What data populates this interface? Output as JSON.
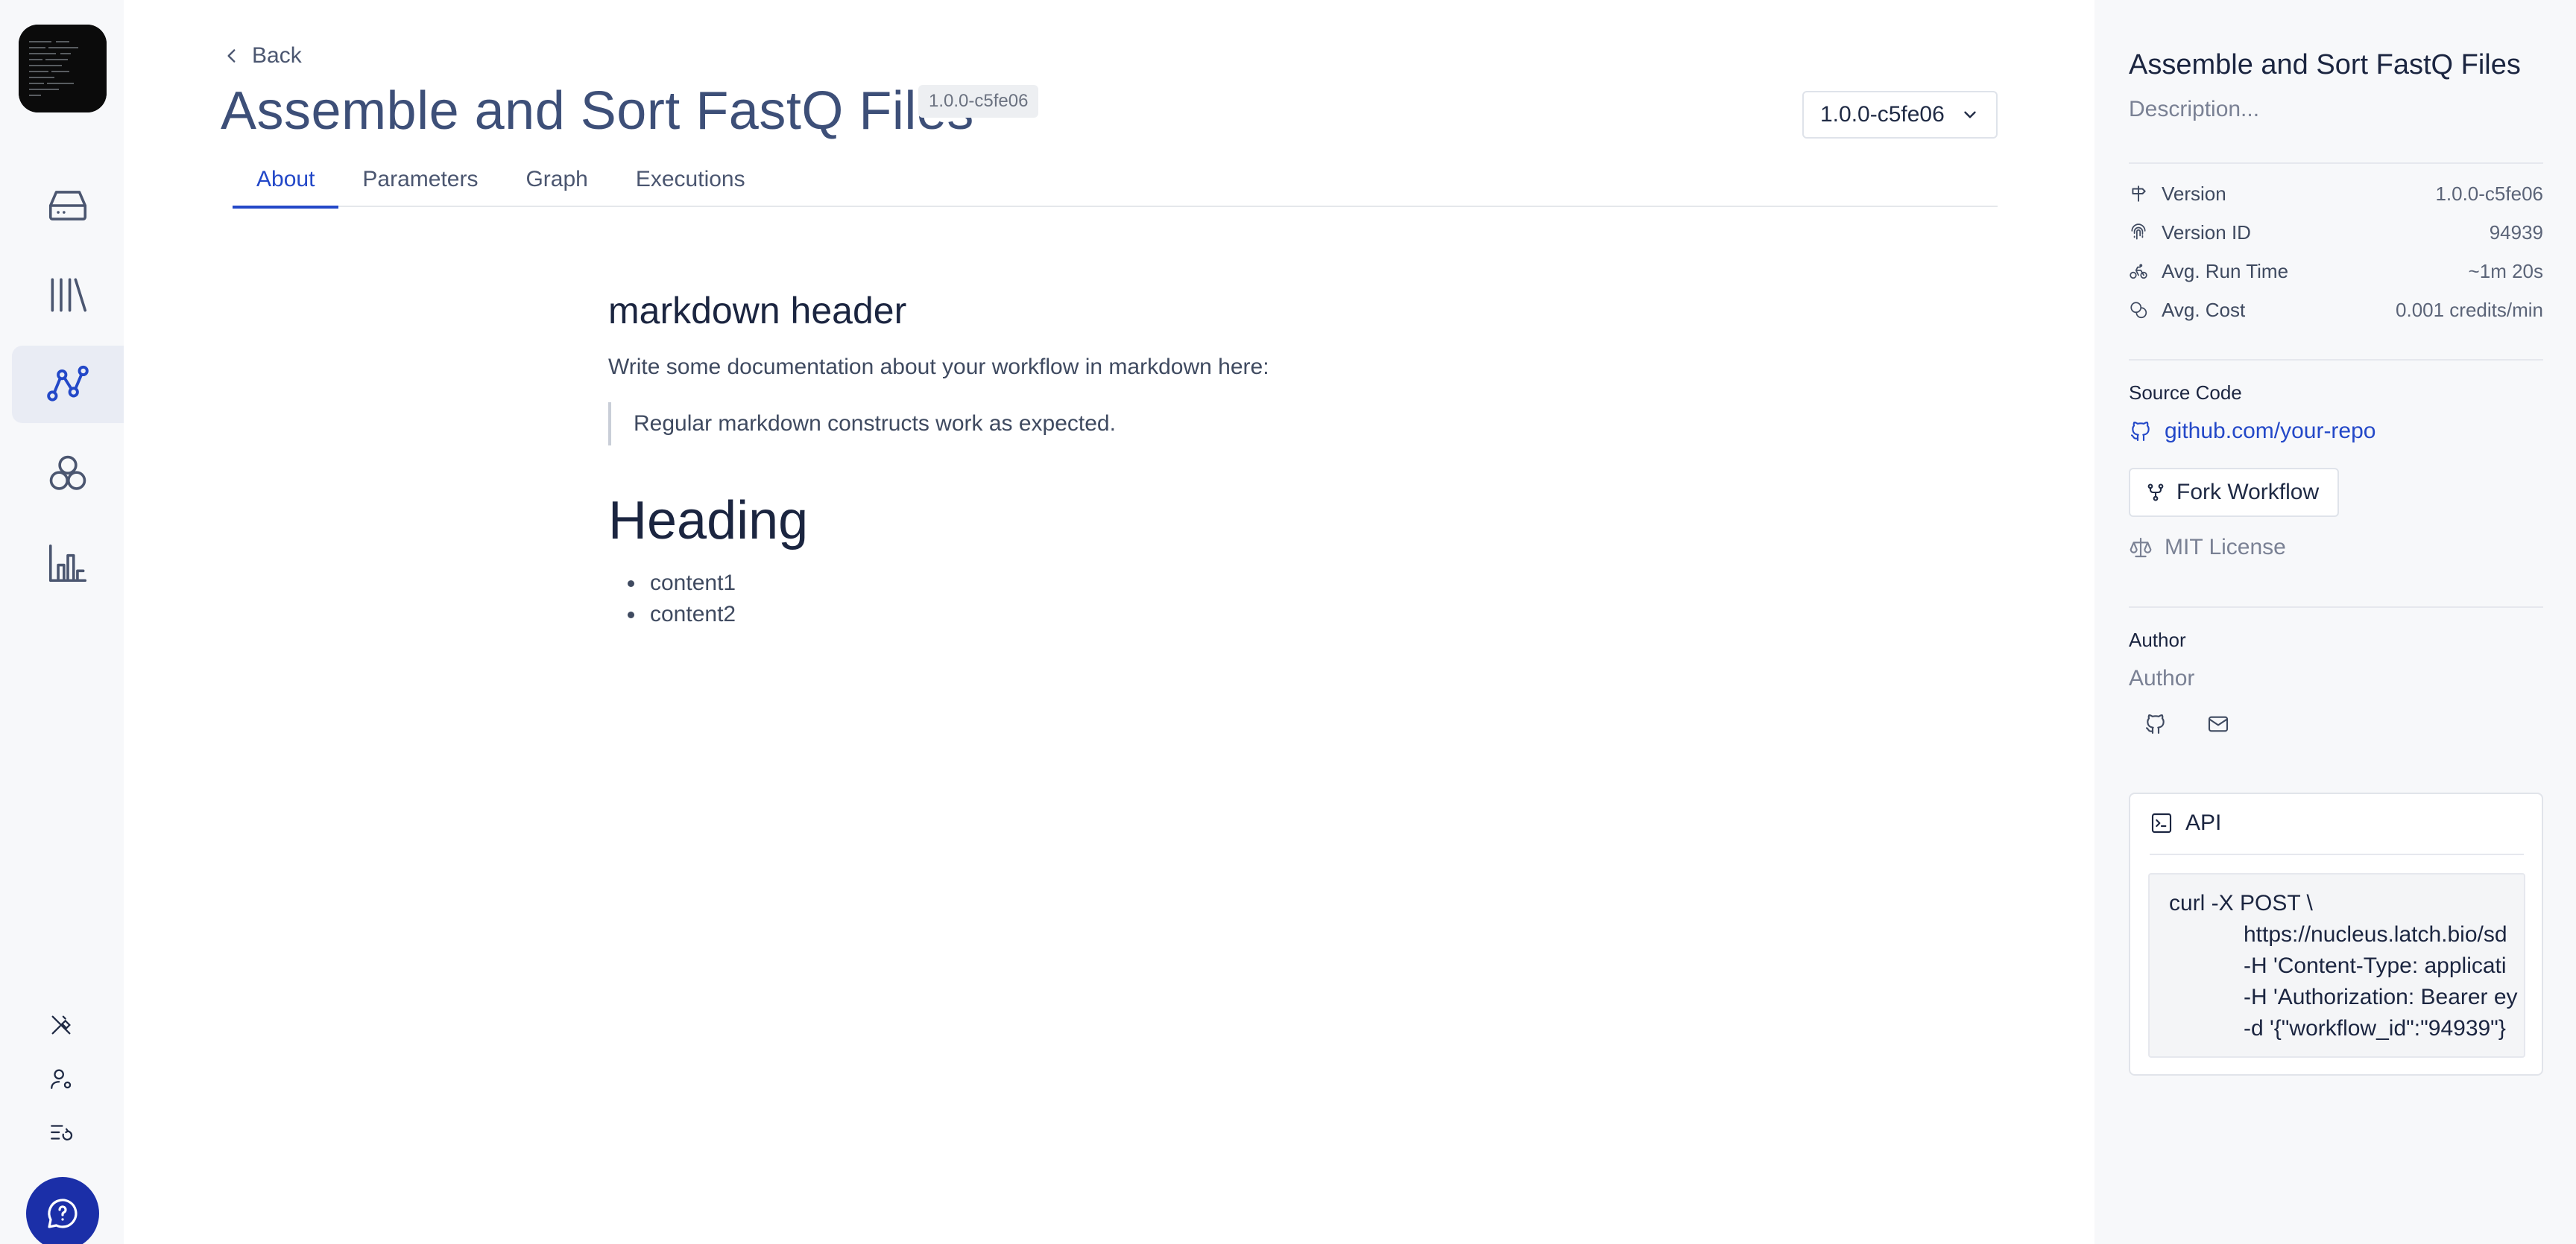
{
  "app": {
    "logo": "latch-terminal-logo",
    "nav": [
      {
        "icon": "drive-icon",
        "active": false
      },
      {
        "icon": "library-icon",
        "active": false
      },
      {
        "icon": "workflow-graph-icon",
        "active": true
      },
      {
        "icon": "hexagons-icon",
        "active": false
      },
      {
        "icon": "bar-chart-icon",
        "active": false
      }
    ],
    "bottom_nav": [
      "tools-icon",
      "user-settings-icon",
      "task-list-icon"
    ],
    "help_icon": "help-chat-icon",
    "accent_color": "#2348c8",
    "help_color": "#1b2fa8"
  },
  "header": {
    "back_label": "Back",
    "title": "Assemble and Sort FastQ Files",
    "version_tag": "1.0.0-c5fe06",
    "version_select": "1.0.0-c5fe06"
  },
  "tabs": [
    {
      "label": "About",
      "active": true
    },
    {
      "label": "Parameters",
      "active": false
    },
    {
      "label": "Graph",
      "active": false
    },
    {
      "label": "Executions",
      "active": false
    }
  ],
  "doc": {
    "h2": "markdown header",
    "paragraph": "Write some documentation about your workflow in markdown here:",
    "quote": "Regular markdown constructs work as expected.",
    "h1": "Heading",
    "list": [
      "content1",
      "content2"
    ]
  },
  "sidebar": {
    "title": "Assemble and Sort FastQ Files",
    "description": "Description...",
    "meta": [
      {
        "icon": "signpost-icon",
        "label": "Version",
        "value": "1.0.0-c5fe06"
      },
      {
        "icon": "fingerprint-icon",
        "label": "Version ID",
        "value": "94939"
      },
      {
        "icon": "bike-icon",
        "label": "Avg. Run Time",
        "value": "~1m 20s"
      },
      {
        "icon": "coins-icon",
        "label": "Avg. Cost",
        "value": "0.001 credits/min"
      }
    ],
    "source_code_label": "Source Code",
    "repo_link": "github.com/your-repo",
    "fork_label": "Fork Workflow",
    "license": "MIT License",
    "author_label": "Author",
    "author_name": "Author",
    "api": {
      "label": "API",
      "code": [
        "curl -X POST \\",
        "https://nucleus.latch.bio/sd",
        "-H 'Content-Type: applicati",
        "-H 'Authorization: Bearer ey",
        "-d '{\"workflow_id\":\"94939\"}"
      ]
    }
  }
}
